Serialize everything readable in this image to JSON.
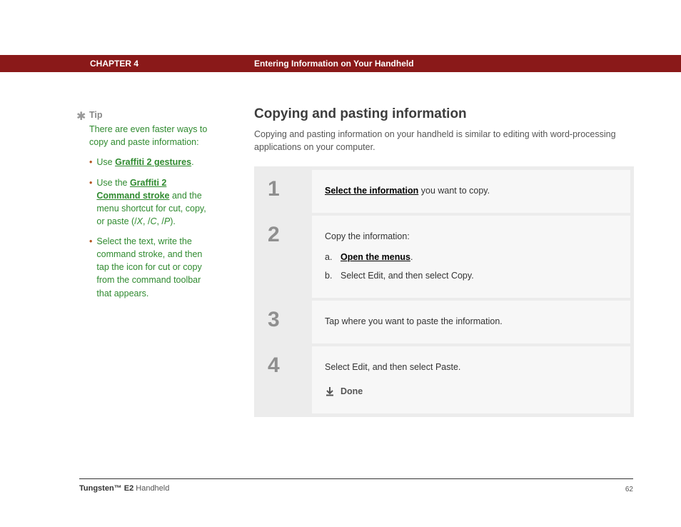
{
  "header": {
    "chapter": "CHAPTER 4",
    "title": "Entering Information on Your Handheld"
  },
  "sidebar": {
    "tip_label": "Tip",
    "intro": "There are even faster ways to copy and paste information:",
    "items": [
      {
        "prefix": "Use ",
        "link": "Graffiti 2 gestures",
        "suffix": "."
      },
      {
        "prefix": "Use the ",
        "link": "Graffiti 2 Command stroke",
        "suffix_before_shortcuts": " and the menu shortcut for cut, copy, or paste (/",
        "sc1": "X",
        "mid1": ", /",
        "sc2": "C",
        "mid2": ", /",
        "sc3": "P",
        "suffix_after": ")."
      },
      {
        "text": "Select the text, write the command stroke, and then tap the icon for cut or copy from the command toolbar that appears."
      }
    ]
  },
  "main": {
    "title": "Copying and pasting information",
    "intro": "Copying and pasting information on your handheld is similar to editing with word-processing applications on your computer."
  },
  "steps": [
    {
      "num": "1",
      "link": "Select the information",
      "after_link": " you want to copy."
    },
    {
      "num": "2",
      "lead": "Copy the information:",
      "subs": [
        {
          "letter": "a.",
          "link": "Open the menus",
          "after": "."
        },
        {
          "letter": "b.",
          "text": "Select Edit, and then select Copy."
        }
      ]
    },
    {
      "num": "3",
      "text": "Tap where you want to paste the information."
    },
    {
      "num": "4",
      "text": "Select Edit, and then select Paste.",
      "done": "Done"
    }
  ],
  "footer": {
    "product_strong": "Tungsten™ E2",
    "product_rest": " Handheld",
    "page": "62"
  }
}
